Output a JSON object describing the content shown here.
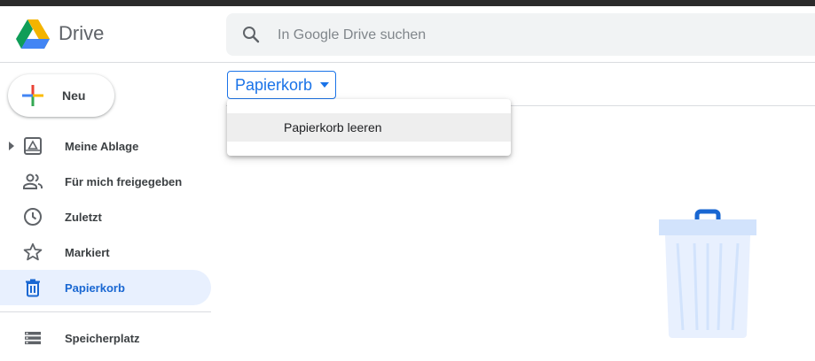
{
  "app": {
    "brand_name": "Drive",
    "brand_colors": {
      "green": "#0f9d58",
      "yellow": "#f4b400",
      "blue": "#4285f4"
    }
  },
  "search": {
    "placeholder": "In Google Drive suchen",
    "icon": "search-icon"
  },
  "new_button": {
    "label": "Neu",
    "icon": "plus-icon"
  },
  "sidebar": {
    "items": [
      {
        "label": "Meine Ablage",
        "icon": "my-drive-icon",
        "active": false,
        "expandable": true
      },
      {
        "label": "Für mich freigegeben",
        "icon": "shared-people-icon",
        "active": false
      },
      {
        "label": "Zuletzt",
        "icon": "clock-icon",
        "active": false
      },
      {
        "label": "Markiert",
        "icon": "star-icon",
        "active": false
      },
      {
        "label": "Papierkorb",
        "icon": "trash-icon",
        "active": true
      },
      {
        "label": "Speicherplatz",
        "icon": "storage-icon",
        "active": false
      }
    ],
    "active_color": "#1967d2",
    "active_bg": "#e8f0fe"
  },
  "main": {
    "breadcrumb": {
      "label": "Papierkorb",
      "icon": "caret-down-icon"
    },
    "dropdown_menu": {
      "items": [
        {
          "label": "Papierkorb leeren",
          "highlighted": true
        }
      ]
    },
    "illustration": "empty-trash-illustration"
  }
}
